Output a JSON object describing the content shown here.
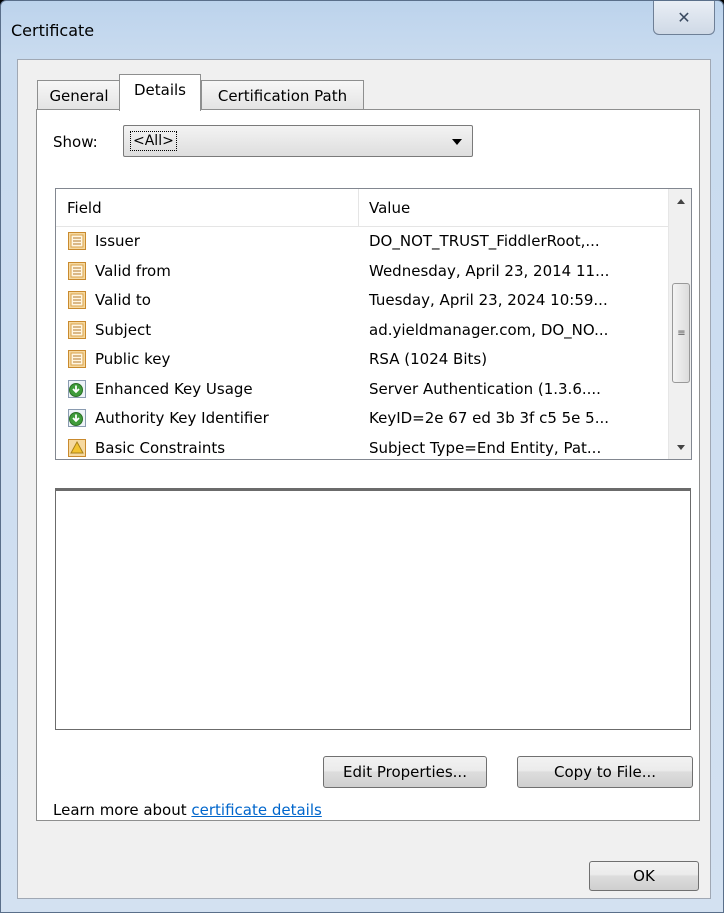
{
  "window": {
    "title": "Certificate",
    "close_glyph": "✕"
  },
  "tabs": [
    {
      "label": "General"
    },
    {
      "label": "Details"
    },
    {
      "label": "Certification Path"
    }
  ],
  "show": {
    "label": "Show:",
    "value": "<All>"
  },
  "list": {
    "columns": {
      "field": "Field",
      "value": "Value"
    },
    "rows": [
      {
        "field": "Issuer",
        "value": "DO_NOT_TRUST_FiddlerRoot,...",
        "icon": "certificate-field-icon"
      },
      {
        "field": "Valid from",
        "value": "Wednesday, April 23, 2014 11...",
        "icon": "certificate-field-icon"
      },
      {
        "field": "Valid to",
        "value": "Tuesday, April 23, 2024 10:59...",
        "icon": "certificate-field-icon"
      },
      {
        "field": "Subject",
        "value": "ad.yieldmanager.com, DO_NO...",
        "icon": "certificate-field-icon"
      },
      {
        "field": "Public key",
        "value": "RSA (1024 Bits)",
        "icon": "certificate-field-icon"
      },
      {
        "field": "Enhanced Key Usage",
        "value": "Server Authentication (1.3.6....",
        "icon": "extension-field-icon"
      },
      {
        "field": "Authority Key Identifier",
        "value": "KeyID=2e 67 ed 3b 3f c5 5e 5...",
        "icon": "extension-field-icon"
      },
      {
        "field": "Basic Constraints",
        "value": "Subject Type=End Entity, Pat...",
        "icon": "critical-extension-icon"
      }
    ]
  },
  "buttons": {
    "edit_properties": "Edit Properties...",
    "copy_to_file": "Copy to File...",
    "ok": "OK"
  },
  "learn_more": {
    "prefix": "Learn more about ",
    "link": "certificate details"
  },
  "scrollbar": {
    "thumb_grip": "≡"
  }
}
